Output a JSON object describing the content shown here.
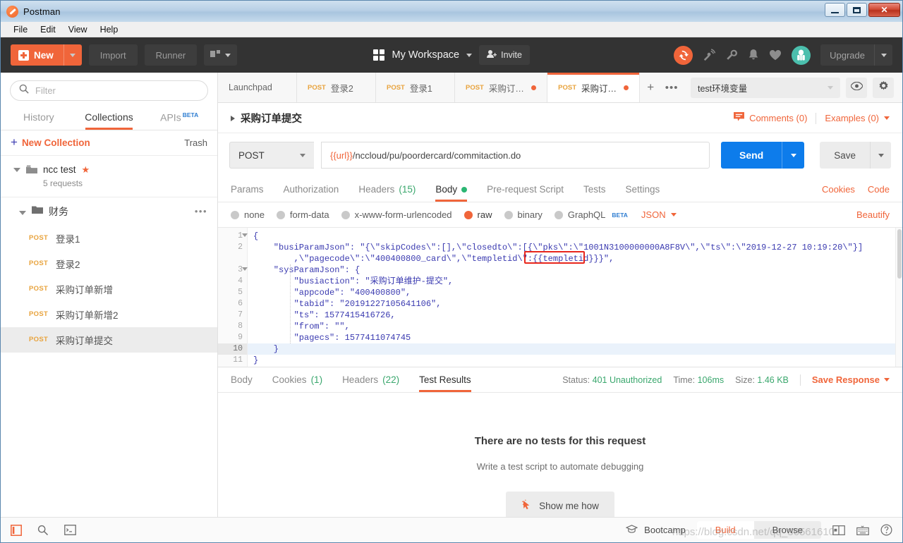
{
  "window": {
    "title": "Postman",
    "logo_icon": "postman-logo-icon",
    "minimize_label": "Minimize",
    "maximize_label": "Maximize",
    "close_label": "Close"
  },
  "menubar": {
    "items": [
      "File",
      "Edit",
      "View",
      "Help"
    ]
  },
  "header": {
    "new_label": "New",
    "import_label": "Import",
    "runner_label": "Runner",
    "open_new_icon": "open-new-window-icon",
    "workspace_icon": "workspace-grid-icon",
    "workspace_label": "My Workspace",
    "invite_label": "Invite",
    "invite_icon": "invite-person-icon",
    "sync_icon": "sync-icon",
    "satellite_icon": "satellite-icon",
    "wrench_icon": "wrench-icon",
    "bell_icon": "bell-icon",
    "heart_icon": "heart-icon",
    "avatar_icon": "user-avatar-icon",
    "upgrade_label": "Upgrade"
  },
  "sidebar": {
    "search_icon": "search-icon",
    "filter_placeholder": "Filter",
    "filter_value": "",
    "tabs": [
      {
        "label": "History",
        "active": false
      },
      {
        "label": "Collections",
        "active": true
      },
      {
        "label": "APIs",
        "badge": "BETA",
        "active": false
      }
    ],
    "new_collection_label": "New Collection",
    "trash_label": "Trash",
    "collection": {
      "name": "ncc test",
      "requests_count": "5 requests",
      "starred": true,
      "folder_icon": "folder-icon",
      "star_icon": "star-icon"
    },
    "folder": {
      "name": "财务",
      "folder_icon": "folder-icon",
      "more_icon": "more-options-icon"
    },
    "requests": [
      {
        "method": "POST",
        "name": "登录1",
        "selected": false
      },
      {
        "method": "POST",
        "name": "登录2",
        "selected": false
      },
      {
        "method": "POST",
        "name": "采购订单新增",
        "selected": false
      },
      {
        "method": "POST",
        "name": "采购订单新增2",
        "selected": false
      },
      {
        "method": "POST",
        "name": "采购订单提交",
        "selected": true
      }
    ]
  },
  "tabs": {
    "items": [
      {
        "label": "Launchpad",
        "method": "",
        "dirty": false,
        "active": false
      },
      {
        "label": "登录2",
        "method": "POST",
        "dirty": false,
        "active": false
      },
      {
        "label": "登录1",
        "method": "POST",
        "dirty": false,
        "active": false
      },
      {
        "label": "采购订单...",
        "method": "POST",
        "dirty": true,
        "active": false
      },
      {
        "label": "采购订单...",
        "method": "POST",
        "dirty": true,
        "active": true
      }
    ],
    "new_tab_label": "+",
    "more_label": "•••"
  },
  "environment": {
    "selected": "test环境变量",
    "eye_icon": "eye-icon",
    "gear_icon": "gear-icon"
  },
  "request": {
    "title": "采购订单提交",
    "comments_label": "Comments (0)",
    "comments_icon": "comment-icon",
    "examples_label": "Examples (0)",
    "method": "POST",
    "url": "{{url}}/nccloud/pu/poordercard/commitaction.do",
    "url_variable": "{{url}}",
    "url_rest": "/nccloud/pu/poordercard/commitaction.do",
    "send_label": "Send",
    "save_label": "Save",
    "tabs": [
      {
        "label": "Params",
        "active": false
      },
      {
        "label": "Authorization",
        "active": false
      },
      {
        "label": "Headers",
        "count": "(15)",
        "active": false
      },
      {
        "label": "Body",
        "dot": true,
        "active": true
      },
      {
        "label": "Pre-request Script",
        "active": false
      },
      {
        "label": "Tests",
        "active": false
      },
      {
        "label": "Settings",
        "active": false
      }
    ],
    "cookies_link": "Cookies",
    "code_link": "Code",
    "body_types": [
      {
        "label": "none",
        "selected": false
      },
      {
        "label": "form-data",
        "selected": false
      },
      {
        "label": "x-www-form-urlencoded",
        "selected": false
      },
      {
        "label": "raw",
        "selected": true
      },
      {
        "label": "binary",
        "selected": false
      },
      {
        "label": "GraphQL",
        "badge": "BETA",
        "selected": false
      }
    ],
    "format": "JSON",
    "beautify_label": "Beautify"
  },
  "editor": {
    "lines": [
      {
        "num": "1",
        "fold": true,
        "text": "{",
        "hl": false
      },
      {
        "num": "2",
        "fold": false,
        "text": "    \"busiParamJson\": \"{\\\"skipCodes\\\":[],\\\"closedto\\\":[{\\\"pks\\\":\\\"1001N3100000000A8F8V\\\",\\\"ts\\\":\\\"2019-12-27 10:19:20\\\"}]",
        "hl": false
      },
      {
        "num": "",
        "fold": false,
        "text": "        ,\\\"pagecode\\\":\\\"400400800_card\\\",\\\"templetid\\\":{{templetid}}}\",",
        "hl": false
      },
      {
        "num": "3",
        "fold": true,
        "text": "    \"sysParamJson\": {",
        "hl": false
      },
      {
        "num": "4",
        "fold": false,
        "text": "        \"busiaction\": \"采购订单维护-提交\",",
        "hl": false
      },
      {
        "num": "5",
        "fold": false,
        "text": "        \"appcode\": \"400400800\",",
        "hl": false
      },
      {
        "num": "6",
        "fold": false,
        "text": "        \"tabid\": \"20191227105641106\",",
        "hl": false
      },
      {
        "num": "7",
        "fold": false,
        "text": "        \"ts\": 1577415416726,",
        "hl": false
      },
      {
        "num": "8",
        "fold": false,
        "text": "        \"from\": \"\",",
        "hl": false
      },
      {
        "num": "9",
        "fold": false,
        "text": "        \"pagecs\": 1577411074745",
        "hl": false
      },
      {
        "num": "10",
        "fold": false,
        "text": "    }",
        "hl": true
      },
      {
        "num": "11",
        "fold": false,
        "text": "}",
        "hl": false
      }
    ],
    "highlight_variable": "{{templetid}}",
    "highlight_color": "#e8271c"
  },
  "response": {
    "tabs": [
      {
        "label": "Body",
        "active": false
      },
      {
        "label": "Cookies",
        "count": "(1)",
        "active": false
      },
      {
        "label": "Headers",
        "count": "(22)",
        "active": false
      },
      {
        "label": "Test Results",
        "active": true
      }
    ],
    "status_label": "Status:",
    "status_value": "401 Unauthorized",
    "time_label": "Time:",
    "time_value": "106ms",
    "size_label": "Size:",
    "size_value": "1.46 KB",
    "save_response_label": "Save Response",
    "empty_title": "There are no tests for this request",
    "empty_subtitle": "Write a test script to automate debugging",
    "show_me_how_label": "Show me how",
    "cursor_icon": "cursor-click-icon"
  },
  "statusbar": {
    "sidebar_toggle_icon": "sidebar-toggle-icon",
    "find_icon": "search-icon",
    "console_icon": "console-icon",
    "bootcamp_label": "Bootcamp",
    "bootcamp_icon": "graduation-cap-icon",
    "build_label": "Build",
    "browse_label": "Browse",
    "layout_icon": "two-pane-layout-icon",
    "keyboard_icon": "keyboard-icon",
    "help_icon": "help-icon",
    "watermark": "https://blog.csdn.net/qq_36561610"
  },
  "colors": {
    "accent": "#f0653a",
    "send": "#0d7ceb",
    "green": "#3aa76d",
    "dark_header": "#333333"
  }
}
